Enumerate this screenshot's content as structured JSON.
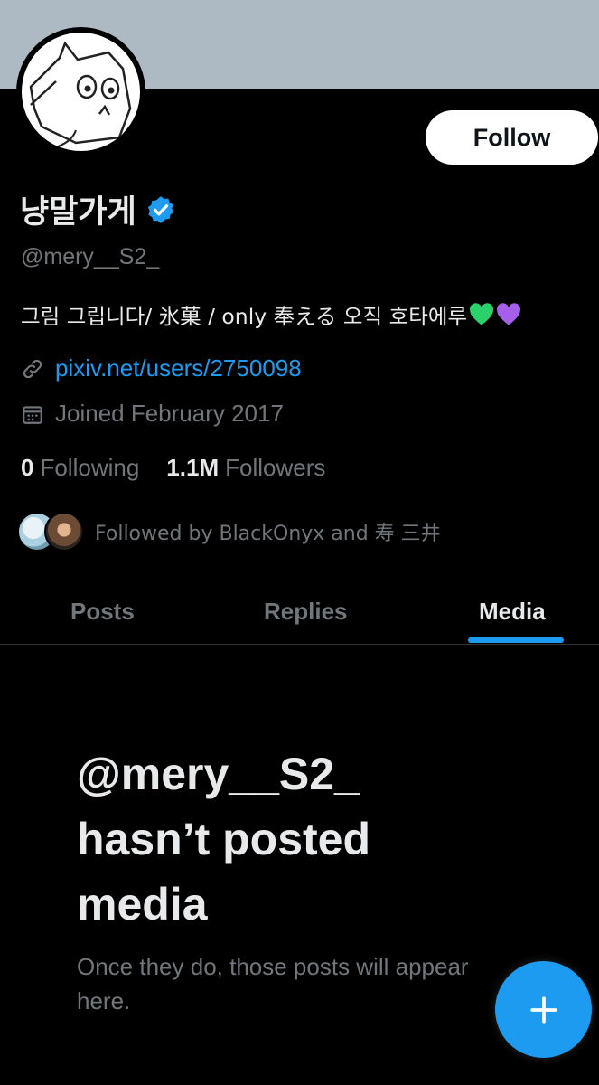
{
  "profile": {
    "display_name": "냥말가게",
    "handle": "@mery__S2_",
    "bio": "그림 그립니다/ 氷菓 / only 奉える 오직 호타에루",
    "bio_emojis": [
      "green-heart",
      "purple-heart"
    ],
    "link": "pixiv.net/users/2750098",
    "joined": "Joined February 2017",
    "verified": true
  },
  "follow_button": {
    "label": "Follow"
  },
  "stats": {
    "following_count": "0",
    "following_label": "Following",
    "followers_count": "1.1M",
    "followers_label": "Followers"
  },
  "followed_by": "Followed by BlackOnyx and 寿 三井",
  "tabs": [
    {
      "label": "Posts",
      "active": false
    },
    {
      "label": "Replies",
      "active": false
    },
    {
      "label": "Media",
      "active": true
    }
  ],
  "empty_state": {
    "title": "@mery__S2_ hasn’t posted media",
    "subtitle": "Once they do, those posts will appear here."
  },
  "fab": {
    "icon": "plus-icon"
  },
  "colors": {
    "background": "#000000",
    "banner": "#aebac3",
    "accent": "#1d9bf0",
    "muted_text": "#71767b",
    "primary_text": "#e7e9ea"
  }
}
